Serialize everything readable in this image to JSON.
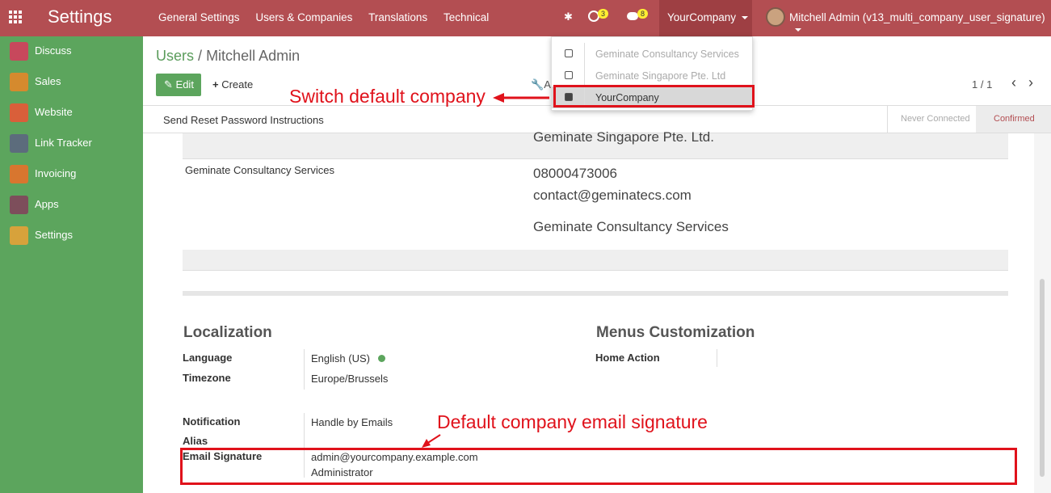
{
  "app": {
    "title": "Settings"
  },
  "topbar": {
    "menu": [
      "General Settings",
      "Users & Companies",
      "Translations",
      "Technical"
    ],
    "activity_count": "3",
    "message_count": "8",
    "company": "YourCompany",
    "user": "Mitchell Admin (v13_multi_company_user_signature)"
  },
  "sidebar": {
    "items": [
      {
        "label": "Discuss",
        "color": "#c7485c"
      },
      {
        "label": "Sales",
        "color": "#d58a2e"
      },
      {
        "label": "Website",
        "color": "#d95f3a"
      },
      {
        "label": "Link Tracker",
        "color": "#5c6c7c"
      },
      {
        "label": "Invoicing",
        "color": "#d8762f"
      },
      {
        "label": "Apps",
        "color": "#7d4e5b"
      },
      {
        "label": "Settings",
        "color": "#d7a23b"
      }
    ]
  },
  "breadcrumb": {
    "parent": "Users",
    "sep": "/",
    "current": "Mitchell Admin"
  },
  "buttons": {
    "edit": "Edit",
    "create": "Create",
    "action": "A",
    "reset": "Send Reset Password Instructions"
  },
  "pager": {
    "value": "1 / 1"
  },
  "status": {
    "never": "Never Connected",
    "confirmed": "Confirmed"
  },
  "dropdown": {
    "items": [
      {
        "label": "Geminate Consultancy Services",
        "checked": false
      },
      {
        "label": "Geminate Singapore Pte. Ltd",
        "checked": false
      },
      {
        "label": "YourCompany",
        "checked": true
      }
    ]
  },
  "companies": {
    "sg_name": "Geminate Singapore Pte. Ltd.",
    "gcs_label": "Geminate Consultancy Services",
    "gcs_phone": "08000473006",
    "gcs_email": "contact@geminatecs.com",
    "gcs_name": "Geminate Consultancy Services"
  },
  "localization": {
    "title": "Localization",
    "language_label": "Language",
    "language_value": "English (US)",
    "timezone_label": "Timezone",
    "timezone_value": "Europe/Brussels"
  },
  "menus": {
    "title": "Menus Customization",
    "home_action_label": "Home Action"
  },
  "prefs": {
    "notification_label": "Notification",
    "notification_value": "Handle by Emails",
    "alias_label": "Alias",
    "signature_label": "Email Signature",
    "signature_line1": "admin@yourcompany.example.com",
    "signature_line2": "Administrator"
  },
  "annotations": {
    "switch_company": "Switch default company",
    "email_signature": "Default company email signature",
    "color": "#e0121b"
  }
}
